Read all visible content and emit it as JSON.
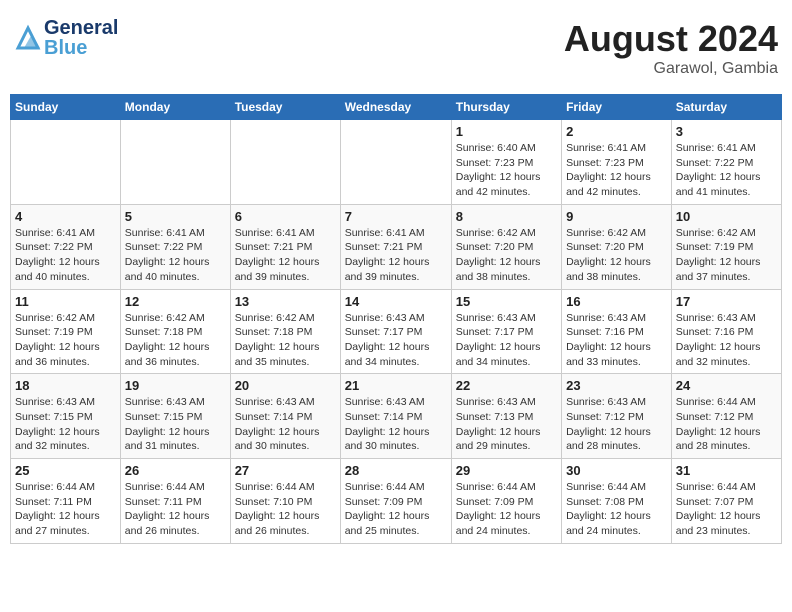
{
  "header": {
    "logo_general": "General",
    "logo_blue": "Blue",
    "title": "August 2024",
    "subtitle": "Garawol, Gambia"
  },
  "weekdays": [
    "Sunday",
    "Monday",
    "Tuesday",
    "Wednesday",
    "Thursday",
    "Friday",
    "Saturday"
  ],
  "weeks": [
    [
      {
        "day": "",
        "info": ""
      },
      {
        "day": "",
        "info": ""
      },
      {
        "day": "",
        "info": ""
      },
      {
        "day": "",
        "info": ""
      },
      {
        "day": "1",
        "info": "Sunrise: 6:40 AM\nSunset: 7:23 PM\nDaylight: 12 hours\nand 42 minutes."
      },
      {
        "day": "2",
        "info": "Sunrise: 6:41 AM\nSunset: 7:23 PM\nDaylight: 12 hours\nand 42 minutes."
      },
      {
        "day": "3",
        "info": "Sunrise: 6:41 AM\nSunset: 7:22 PM\nDaylight: 12 hours\nand 41 minutes."
      }
    ],
    [
      {
        "day": "4",
        "info": "Sunrise: 6:41 AM\nSunset: 7:22 PM\nDaylight: 12 hours\nand 40 minutes."
      },
      {
        "day": "5",
        "info": "Sunrise: 6:41 AM\nSunset: 7:22 PM\nDaylight: 12 hours\nand 40 minutes."
      },
      {
        "day": "6",
        "info": "Sunrise: 6:41 AM\nSunset: 7:21 PM\nDaylight: 12 hours\nand 39 minutes."
      },
      {
        "day": "7",
        "info": "Sunrise: 6:41 AM\nSunset: 7:21 PM\nDaylight: 12 hours\nand 39 minutes."
      },
      {
        "day": "8",
        "info": "Sunrise: 6:42 AM\nSunset: 7:20 PM\nDaylight: 12 hours\nand 38 minutes."
      },
      {
        "day": "9",
        "info": "Sunrise: 6:42 AM\nSunset: 7:20 PM\nDaylight: 12 hours\nand 38 minutes."
      },
      {
        "day": "10",
        "info": "Sunrise: 6:42 AM\nSunset: 7:19 PM\nDaylight: 12 hours\nand 37 minutes."
      }
    ],
    [
      {
        "day": "11",
        "info": "Sunrise: 6:42 AM\nSunset: 7:19 PM\nDaylight: 12 hours\nand 36 minutes."
      },
      {
        "day": "12",
        "info": "Sunrise: 6:42 AM\nSunset: 7:18 PM\nDaylight: 12 hours\nand 36 minutes."
      },
      {
        "day": "13",
        "info": "Sunrise: 6:42 AM\nSunset: 7:18 PM\nDaylight: 12 hours\nand 35 minutes."
      },
      {
        "day": "14",
        "info": "Sunrise: 6:43 AM\nSunset: 7:17 PM\nDaylight: 12 hours\nand 34 minutes."
      },
      {
        "day": "15",
        "info": "Sunrise: 6:43 AM\nSunset: 7:17 PM\nDaylight: 12 hours\nand 34 minutes."
      },
      {
        "day": "16",
        "info": "Sunrise: 6:43 AM\nSunset: 7:16 PM\nDaylight: 12 hours\nand 33 minutes."
      },
      {
        "day": "17",
        "info": "Sunrise: 6:43 AM\nSunset: 7:16 PM\nDaylight: 12 hours\nand 32 minutes."
      }
    ],
    [
      {
        "day": "18",
        "info": "Sunrise: 6:43 AM\nSunset: 7:15 PM\nDaylight: 12 hours\nand 32 minutes."
      },
      {
        "day": "19",
        "info": "Sunrise: 6:43 AM\nSunset: 7:15 PM\nDaylight: 12 hours\nand 31 minutes."
      },
      {
        "day": "20",
        "info": "Sunrise: 6:43 AM\nSunset: 7:14 PM\nDaylight: 12 hours\nand 30 minutes."
      },
      {
        "day": "21",
        "info": "Sunrise: 6:43 AM\nSunset: 7:14 PM\nDaylight: 12 hours\nand 30 minutes."
      },
      {
        "day": "22",
        "info": "Sunrise: 6:43 AM\nSunset: 7:13 PM\nDaylight: 12 hours\nand 29 minutes."
      },
      {
        "day": "23",
        "info": "Sunrise: 6:43 AM\nSunset: 7:12 PM\nDaylight: 12 hours\nand 28 minutes."
      },
      {
        "day": "24",
        "info": "Sunrise: 6:44 AM\nSunset: 7:12 PM\nDaylight: 12 hours\nand 28 minutes."
      }
    ],
    [
      {
        "day": "25",
        "info": "Sunrise: 6:44 AM\nSunset: 7:11 PM\nDaylight: 12 hours\nand 27 minutes."
      },
      {
        "day": "26",
        "info": "Sunrise: 6:44 AM\nSunset: 7:11 PM\nDaylight: 12 hours\nand 26 minutes."
      },
      {
        "day": "27",
        "info": "Sunrise: 6:44 AM\nSunset: 7:10 PM\nDaylight: 12 hours\nand 26 minutes."
      },
      {
        "day": "28",
        "info": "Sunrise: 6:44 AM\nSunset: 7:09 PM\nDaylight: 12 hours\nand 25 minutes."
      },
      {
        "day": "29",
        "info": "Sunrise: 6:44 AM\nSunset: 7:09 PM\nDaylight: 12 hours\nand 24 minutes."
      },
      {
        "day": "30",
        "info": "Sunrise: 6:44 AM\nSunset: 7:08 PM\nDaylight: 12 hours\nand 24 minutes."
      },
      {
        "day": "31",
        "info": "Sunrise: 6:44 AM\nSunset: 7:07 PM\nDaylight: 12 hours\nand 23 minutes."
      }
    ]
  ],
  "colors": {
    "header_bg": "#2a6db5",
    "header_text": "#ffffff",
    "logo_dark": "#1a3a6b",
    "logo_light": "#4a9fd4"
  }
}
